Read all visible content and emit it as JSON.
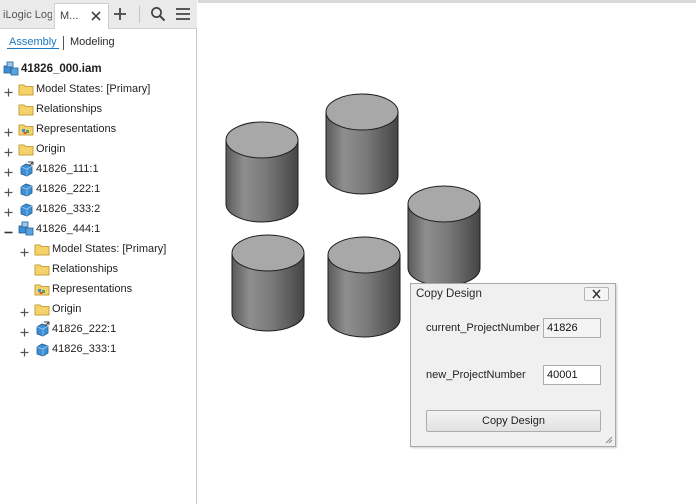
{
  "tabs": {
    "ilogic_label": "iLogic Log",
    "model_label": "M...",
    "close_icon": "close-icon",
    "add_icon": "plus-icon",
    "search_icon": "search-icon",
    "menu_icon": "hamburger-menu-icon"
  },
  "modes": {
    "assembly": "Assembly",
    "modeling": "Modeling"
  },
  "tree": {
    "root": {
      "label": "41826_000.iam",
      "icon": "assembly-icon"
    },
    "items": [
      {
        "label": "Model States: [Primary]",
        "icon": "folder-icon",
        "expander": "plus"
      },
      {
        "label": "Relationships",
        "icon": "folder-icon",
        "expander": "none"
      },
      {
        "label": "Representations",
        "icon": "folder-representations-icon",
        "expander": "plus"
      },
      {
        "label": "Origin",
        "icon": "folder-icon",
        "expander": "plus"
      },
      {
        "label": "41826_111:1",
        "icon": "part-edit-icon",
        "expander": "plus"
      },
      {
        "label": "41826_222:1",
        "icon": "part-icon",
        "expander": "plus"
      },
      {
        "label": "41826_333:2",
        "icon": "part-icon",
        "expander": "plus"
      },
      {
        "label": "41826_444:1",
        "icon": "assembly-icon",
        "expander": "minus"
      },
      {
        "label": "Model States: [Primary]",
        "icon": "folder-icon",
        "expander": "plus"
      },
      {
        "label": "Relationships",
        "icon": "folder-icon",
        "expander": "none"
      },
      {
        "label": "Representations",
        "icon": "folder-representations-icon",
        "expander": "none"
      },
      {
        "label": "Origin",
        "icon": "folder-icon",
        "expander": "plus"
      },
      {
        "label": "41826_222:1",
        "icon": "part-edit-icon",
        "expander": "plus"
      },
      {
        "label": "41826_333:1",
        "icon": "part-icon",
        "expander": "plus"
      }
    ]
  },
  "dialog": {
    "title": "Copy Design",
    "current_label": "current_ProjectNumber",
    "current_value": "41826",
    "new_label": "new_ProjectNumber",
    "new_value": "40001",
    "button_label": "Copy Design"
  },
  "colors": {
    "accent": "#1a78c2",
    "folder": "#f2c94c",
    "part_blue": "#3d8fd6",
    "cylinder_gray": "#8a8a8a"
  }
}
